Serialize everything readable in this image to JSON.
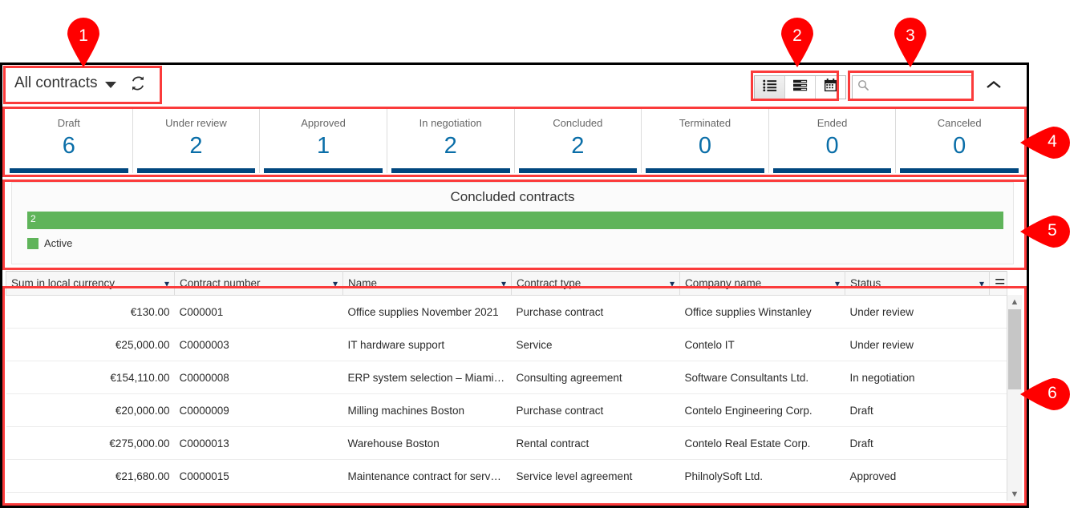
{
  "toolbar": {
    "view_selector_label": "All contracts",
    "refresh_icon": "refresh-icon",
    "caret_icon": "chevron-down-icon",
    "collapse_icon": "chevron-up-icon",
    "view_buttons": [
      {
        "name": "list-view",
        "icon": "list-view-icon",
        "selected": true
      },
      {
        "name": "detail-view",
        "icon": "detail-view-icon",
        "selected": false
      },
      {
        "name": "calendar-view",
        "icon": "calendar-view-icon",
        "selected": false
      }
    ],
    "search": {
      "placeholder": "",
      "value": "",
      "icon": "search-icon"
    }
  },
  "kpis": [
    {
      "label": "Draft",
      "value": "6"
    },
    {
      "label": "Under review",
      "value": "2"
    },
    {
      "label": "Approved",
      "value": "1"
    },
    {
      "label": "In negotiation",
      "value": "2"
    },
    {
      "label": "Concluded",
      "value": "2"
    },
    {
      "label": "Terminated",
      "value": "0"
    },
    {
      "label": "Ended",
      "value": "0"
    },
    {
      "label": "Canceled",
      "value": "0"
    }
  ],
  "chart_data": {
    "type": "bar",
    "title": "Concluded contracts",
    "orientation": "horizontal",
    "categories": [
      "Active"
    ],
    "values": [
      2
    ],
    "data_labels": [
      "2"
    ],
    "series": [
      {
        "name": "Active",
        "values": [
          2
        ],
        "color": "#5fb45a"
      }
    ],
    "legend": [
      {
        "label": "Active",
        "color": "#5fb45a"
      }
    ],
    "legend_position": "bottom-left",
    "xlabel": "",
    "ylabel": "",
    "grid": false
  },
  "table": {
    "columns": [
      {
        "label": "Sum in local currency",
        "align": "right",
        "sort_icon": "chevron-down-icon"
      },
      {
        "label": "Contract number",
        "align": "left",
        "sort_icon": "chevron-down-icon"
      },
      {
        "label": "Name",
        "align": "left",
        "sort_icon": "chevron-down-icon"
      },
      {
        "label": "Contract type",
        "align": "left",
        "sort_icon": "chevron-down-icon"
      },
      {
        "label": "Company name",
        "align": "left",
        "sort_icon": "chevron-down-icon"
      },
      {
        "label": "Status",
        "align": "left",
        "sort_icon": "chevron-down-icon"
      }
    ],
    "menu_icon": "hamburger-menu-icon",
    "rows": [
      {
        "sum": "€130.00",
        "number": "C000001",
        "name": "Office supplies November 2021",
        "type": "Purchase contract",
        "company": "Office supplies Winstanley",
        "status": "Under review"
      },
      {
        "sum": "€25,000.00",
        "number": "C0000003",
        "name": "IT hardware support",
        "type": "Service",
        "company": "Contelo IT",
        "status": "Under review"
      },
      {
        "sum": "€154,110.00",
        "number": "C0000008",
        "name": "ERP system selection – Miami branch",
        "type": "Consulting agreement",
        "company": "Software Consultants Ltd.",
        "status": "In negotiation"
      },
      {
        "sum": "€20,000.00",
        "number": "C0000009",
        "name": "Milling machines Boston",
        "type": "Purchase contract",
        "company": "Contelo Engineering Corp.",
        "status": "Draft"
      },
      {
        "sum": "€275,000.00",
        "number": "C0000013",
        "name": "Warehouse Boston",
        "type": "Rental contract",
        "company": "Contelo Real Estate Corp.",
        "status": "Draft"
      },
      {
        "sum": "€21,680.00",
        "number": "C0000015",
        "name": "Maintenance contract for server land…",
        "type": "Service level agreement",
        "company": "PhilnolySoft Ltd.",
        "status": "Approved"
      }
    ],
    "scrollbar": {
      "up_arrow": "scroll-up-arrow-icon",
      "down_arrow": "scroll-down-arrow-icon"
    }
  },
  "callouts": [
    {
      "number": "1"
    },
    {
      "number": "2"
    },
    {
      "number": "3"
    },
    {
      "number": "4"
    },
    {
      "number": "5"
    },
    {
      "number": "6"
    }
  ],
  "colors": {
    "callout": "#ff0000",
    "highlight": "#fb3b3b",
    "kpi_value": "#0a6ea8",
    "kpi_bar": "#00477f",
    "chart_green": "#5fb45a"
  }
}
